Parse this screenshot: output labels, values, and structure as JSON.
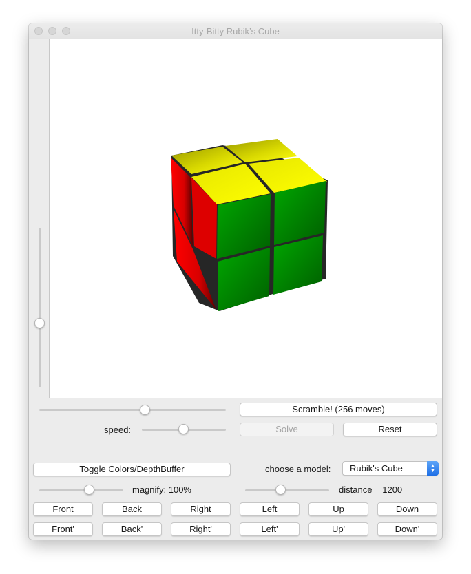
{
  "window": {
    "title": "Itty-Bitty Rubik’s Cube"
  },
  "cube": {
    "top_color": "#ffff00",
    "front_color": "#009900",
    "side_color": "#ff0000",
    "gap_color": "#262626"
  },
  "controls": {
    "rotation_slider_value": 0.6,
    "vertical_slider_value": 0.4,
    "scramble_label": "Scramble!  (256 moves)",
    "speed_label": "speed:",
    "speed_slider_value": 0.5,
    "solve_label": "Solve",
    "reset_label": "Reset",
    "toggle_label": "Toggle Colors/DepthBuffer",
    "model_label": "choose a model:",
    "model_value": "Rubik's Cube",
    "magnify_label": "magnify: 100%",
    "magnify_slider_value": 0.6,
    "distance_label": "distance = 1200",
    "distance_slider_value": 0.42
  },
  "moves": {
    "row1": [
      "Front",
      "Back",
      "Right",
      "Left",
      "Up",
      "Down"
    ],
    "row2": [
      "Front'",
      "Back'",
      "Right'",
      "Left'",
      "Up'",
      "Down'"
    ]
  }
}
